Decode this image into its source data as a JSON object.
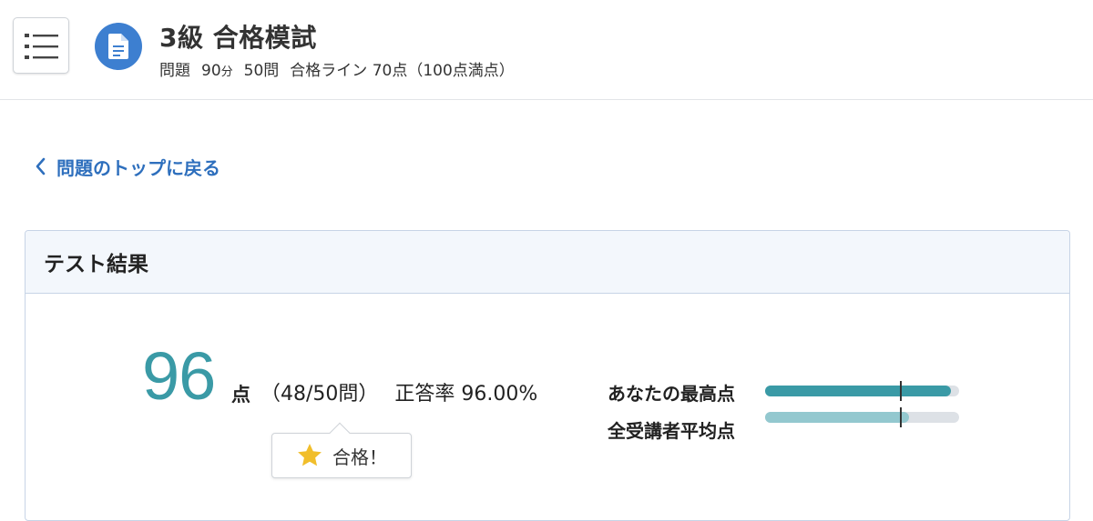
{
  "header": {
    "title": "3級 合格模試",
    "meta": {
      "questions_label": "問題",
      "duration_value": "90",
      "duration_unit": "分",
      "question_count": "50問",
      "pass_line": "合格ライン 70点（100点満点）"
    }
  },
  "nav": {
    "back_label": "問題のトップに戻る"
  },
  "result": {
    "title": "テスト結果",
    "score": "96",
    "score_unit": "点",
    "correct_count": "（48/50問）",
    "accuracy": "正答率 96.00%",
    "pass_status": "合格！",
    "bars": [
      {
        "label": "あなたの最高点",
        "value": 96,
        "pass_line": 70,
        "color": "#3a9aa6"
      },
      {
        "label": "全受講者平均点",
        "value": 74,
        "pass_line": 70,
        "color": "#93c8cf"
      }
    ]
  },
  "colors": {
    "accent_teal": "#3a9aa6",
    "link_blue": "#2e6fbd",
    "doc_icon_bg": "#3d7fd0",
    "star": "#f1be2b"
  }
}
